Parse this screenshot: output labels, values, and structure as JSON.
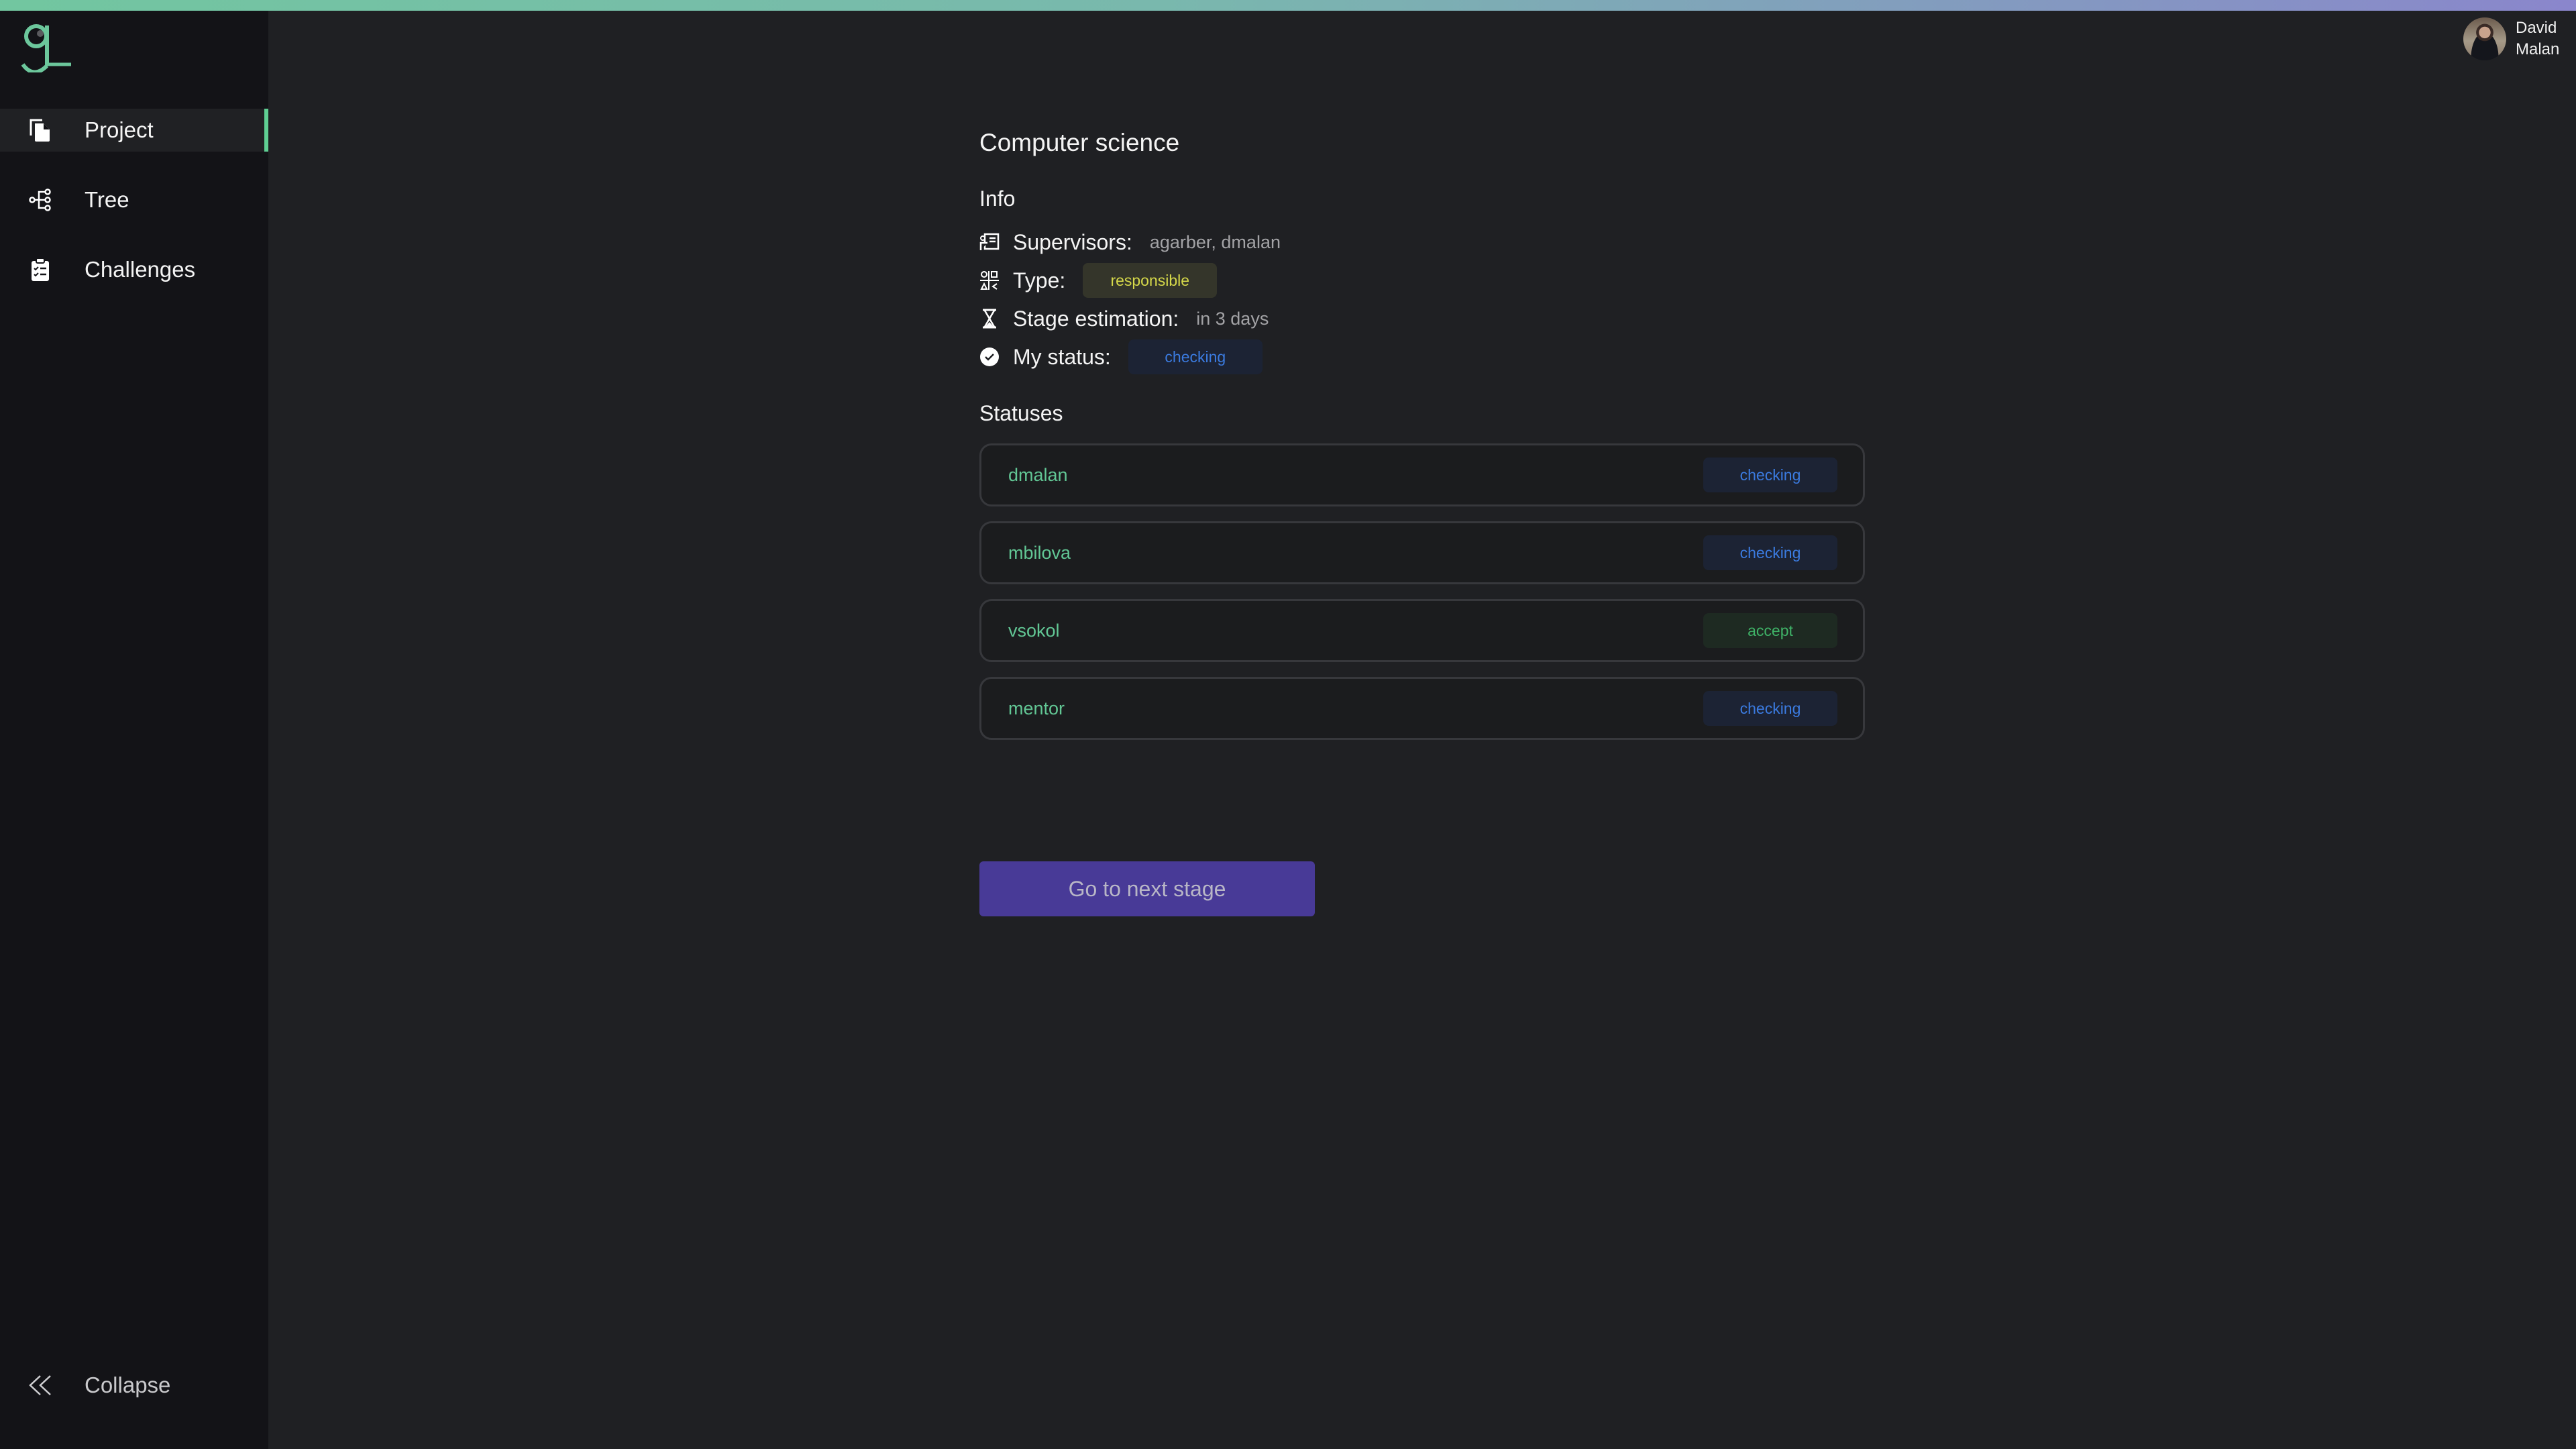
{
  "app": {
    "logo_label": "g",
    "accent_color": "#5fcf93"
  },
  "sidebar": {
    "items": [
      {
        "label": "Project",
        "icon": "copy-file-icon",
        "active": true
      },
      {
        "label": "Tree",
        "icon": "tree-icon",
        "active": false
      },
      {
        "label": "Challenges",
        "icon": "clipboard-checklist-icon",
        "active": false
      }
    ],
    "collapse_label": "Collapse"
  },
  "user": {
    "first_name": "David",
    "last_name": "Malan"
  },
  "project": {
    "title": "Computer science",
    "info_heading": "Info",
    "info": {
      "supervisors_label": "Supervisors:",
      "supervisors_value": "agarber, dmalan",
      "type_label": "Type:",
      "type_value": "responsible",
      "estimation_label": "Stage estimation:",
      "estimation_value": "in 3 days",
      "my_status_label": "My status:",
      "my_status_value": "checking"
    },
    "statuses_heading": "Statuses",
    "statuses": [
      {
        "name": "dmalan",
        "status": "checking",
        "tone": "blue"
      },
      {
        "name": "mbilova",
        "status": "checking",
        "tone": "blue"
      },
      {
        "name": "vsokol",
        "status": "accept",
        "tone": "green"
      },
      {
        "name": "mentor",
        "status": "checking",
        "tone": "blue"
      }
    ],
    "next_stage_button": "Go to next stage"
  },
  "colors": {
    "checking": "#3b7be0",
    "accept": "#3fb267",
    "responsible": "#d6d94a",
    "button": "#483a97"
  }
}
